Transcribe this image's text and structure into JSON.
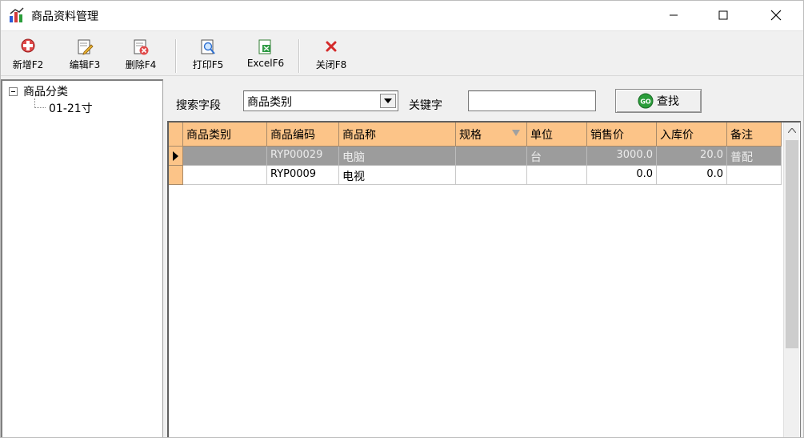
{
  "window": {
    "title": "商品资料管理",
    "controls": {
      "minimize": "—",
      "maximize": "☐",
      "close": "✕"
    }
  },
  "toolbar": {
    "new_label": "新增F2",
    "edit_label": "编辑F3",
    "delete_label": "删除F4",
    "print_label": "打印F5",
    "excel_label": "ExcelF6",
    "close_label": "关闭F8"
  },
  "tree": {
    "root_label": "商品分类",
    "children": [
      "01-21寸"
    ]
  },
  "search": {
    "field_label": "搜索字段",
    "field_value": "商品类别",
    "keyword_label": "关键字",
    "keyword_value": "",
    "find_label": "查找"
  },
  "grid": {
    "columns": [
      "商品类别",
      "商品编码",
      "商品称",
      "规格",
      "单位",
      "销售价",
      "入库价",
      "备注"
    ],
    "rows": [
      {
        "category": "",
        "code": "RYP00029",
        "name": "电脑",
        "spec": "",
        "unit": "台",
        "sale_price": "3000.0",
        "cost_price": "20.0",
        "note": "普配"
      },
      {
        "category": "",
        "code": "RYP0009",
        "name": "电视",
        "spec": "",
        "unit": "",
        "sale_price": "0.0",
        "cost_price": "0.0",
        "note": ""
      }
    ],
    "selected_row": 0
  },
  "colors": {
    "header_bg": "#fcc488",
    "selected_row_bg": "#9c9c9c",
    "window_bg": "#f0f0f0"
  },
  "icons": {
    "app": "app-chart-icon",
    "new": "plus-icon",
    "edit": "edit-pencil-icon",
    "delete": "delete-x-icon",
    "print": "print-preview-icon",
    "excel": "excel-icon",
    "close": "close-x-icon",
    "find": "go-icon"
  }
}
